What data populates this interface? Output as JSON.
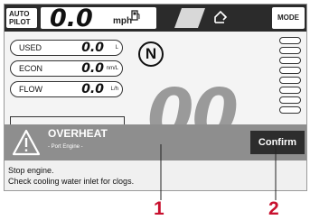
{
  "topbar": {
    "autopilot_line1": "AUTO",
    "autopilot_line2": "PILOT",
    "speed_value": "0.0",
    "speed_unit": "mph",
    "mode_label": "MODE"
  },
  "fields": [
    {
      "label": "USED",
      "value": "0.0",
      "unit": "L"
    },
    {
      "label": "ECON",
      "value": "0.0",
      "unit": "nm/L"
    },
    {
      "label": "FLOW",
      "value": "0.0",
      "unit": "L/h"
    }
  ],
  "gear": "N",
  "big_readout": "00",
  "alert": {
    "title": "OVERHEAT",
    "subtitle": "- Port Engine -",
    "confirm_label": "Confirm",
    "line1": "Stop engine.",
    "line2": "Check cooling water inlet for clogs."
  },
  "callouts": [
    "1",
    "2"
  ],
  "icons": [
    "fuel-icon",
    "steering-icon",
    "warning-icon"
  ],
  "colors": {
    "alert_header": "#8e8e8e",
    "confirm_button": "#2d2d2d",
    "callout": "#c8102e"
  }
}
